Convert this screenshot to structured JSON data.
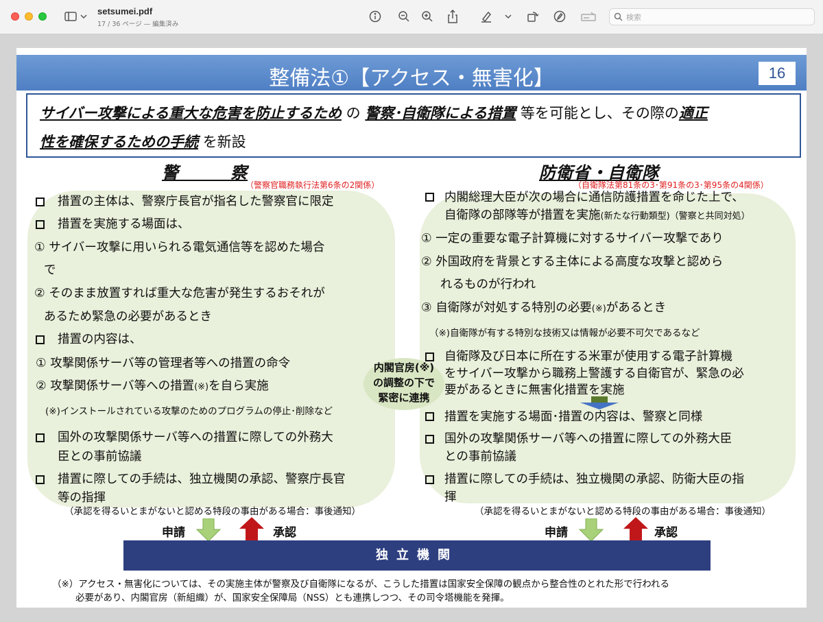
{
  "window": {
    "doc_title": "setsumei.pdf",
    "doc_subtitle": "17 / 36 ページ — 編集済み",
    "search_placeholder": "検索",
    "toolbar_icons": [
      "sidebar-icon",
      "chevron-down-icon",
      "info-icon",
      "zoom-out-icon",
      "zoom-in-icon",
      "share-icon",
      "highlighter-icon",
      "chevron-down-icon",
      "rotate-icon",
      "markup-icon",
      "form-fill-icon",
      "search-icon"
    ]
  },
  "slide": {
    "title": "整備法①【アクセス・無害化】",
    "page_number": "16",
    "summary": {
      "part1": "サイバー攻撃による重大な危害を防止するため",
      "part2": "の",
      "part3": "警察･自衛隊による措置",
      "part4": "等を可能とし、その際の",
      "part5": "適正",
      "part6": "性を確保するための手続",
      "part7": "を新設"
    },
    "police": {
      "heading": "警　　　察",
      "law": "（警察官職務執行法第6条の2関係）",
      "l1": "措置の主体は、警察庁長官が指名した警察官に限定",
      "l2": "措置を実施する場面は、",
      "l3": "①  サイバー攻撃に用いられる電気通信等を認めた場合",
      "l4": "で",
      "l5": "②  そのまま放置すれば重大な危害が発生するおそれが",
      "l6": "あるため緊急の必要があるとき",
      "l7": "措置の内容は、",
      "l8": "①   攻撃関係サーバ等の管理者等への措置の命令",
      "l9a": "②   攻撃関係サーバ等への措置",
      "l9b": "(※)",
      "l9c": "を自ら実施",
      "l10": "(※)インストールされている攻撃のためのプログラムの停止･削除など",
      "l11": "国外の攻撃関係サーバ等への措置に際しての外務大",
      "l12": "臣との事前協議",
      "l13": "措置に際しての手続は、独立機関の承認、警察庁長官",
      "l14": "等の指揮",
      "l15": "（承認を得るいとまがないと認める特段の事由がある場合：事後通知）"
    },
    "sdf": {
      "heading": "防衛省・自衛隊",
      "law": "（自衛隊法第81条の3･第91条の3･第95条の4関係）",
      "r1": "内閣総理大臣が次の場合に通信防護措置を命じた上で、",
      "r2a": "自衛隊の部隊等が措置を実施",
      "r2b": "(新たな行動類型)",
      "r2c": "（警察と共同対処）",
      "r3": "①  一定の重要な電子計算機に対するサイバー攻撃であり",
      "r4": "②  外国政府を背景とする主体による高度な攻撃と認めら",
      "r5": "れるものが行われ",
      "r6a": "③  自衛隊が対処する特別の必要",
      "r6b": "(※)",
      "r6c": "があるとき",
      "r7": "（※)自衛隊が有する特別な技術又は情報が必要不可欠であるなど",
      "r8": "自衛隊及び日本に所在する米軍が使用する電子計算機",
      "r9": "をサイバー攻撃から職務上警護する自衛官が、緊急の必",
      "r10": "要があるときに無害化措置を実施",
      "r11": "措置を実施する場面･措置の内容は、警察と同様",
      "r12": "国外の攻撃関係サーバ等への措置に際しての外務大臣",
      "r13": "との事前協議",
      "r14": "措置に際しての手続は、独立機関の承認、防衛大臣の指",
      "r15": "揮",
      "r16": "（承認を得るいとまがないと認める特段の事由がある場合：事後通知）"
    },
    "coordination": {
      "l1": "内閣官房(※)",
      "l2": "の調整の下で",
      "l3": "緊密に連携"
    },
    "apply_label": "申請",
    "approve_label": "承認",
    "independent_body": "独立機関",
    "footnote1": "（※）アクセス・無害化については、その実施主体が警察及び自衛隊になるが、こうした措置は国家安全保障の観点から整合性のとれた形で行われる",
    "footnote2": "必要があり、内閣官房（新組織）が、国家安全保障局（NSS）とも連携しつつ、その司令塔機能を発揮。",
    "colors": {
      "banner": "#5b8bd0",
      "blob": "#e9f0db",
      "independent_body": "#2e3f80",
      "arrow_down": "#a9d17a",
      "arrow_up": "#c0181a",
      "law_text": "#e02020"
    }
  }
}
